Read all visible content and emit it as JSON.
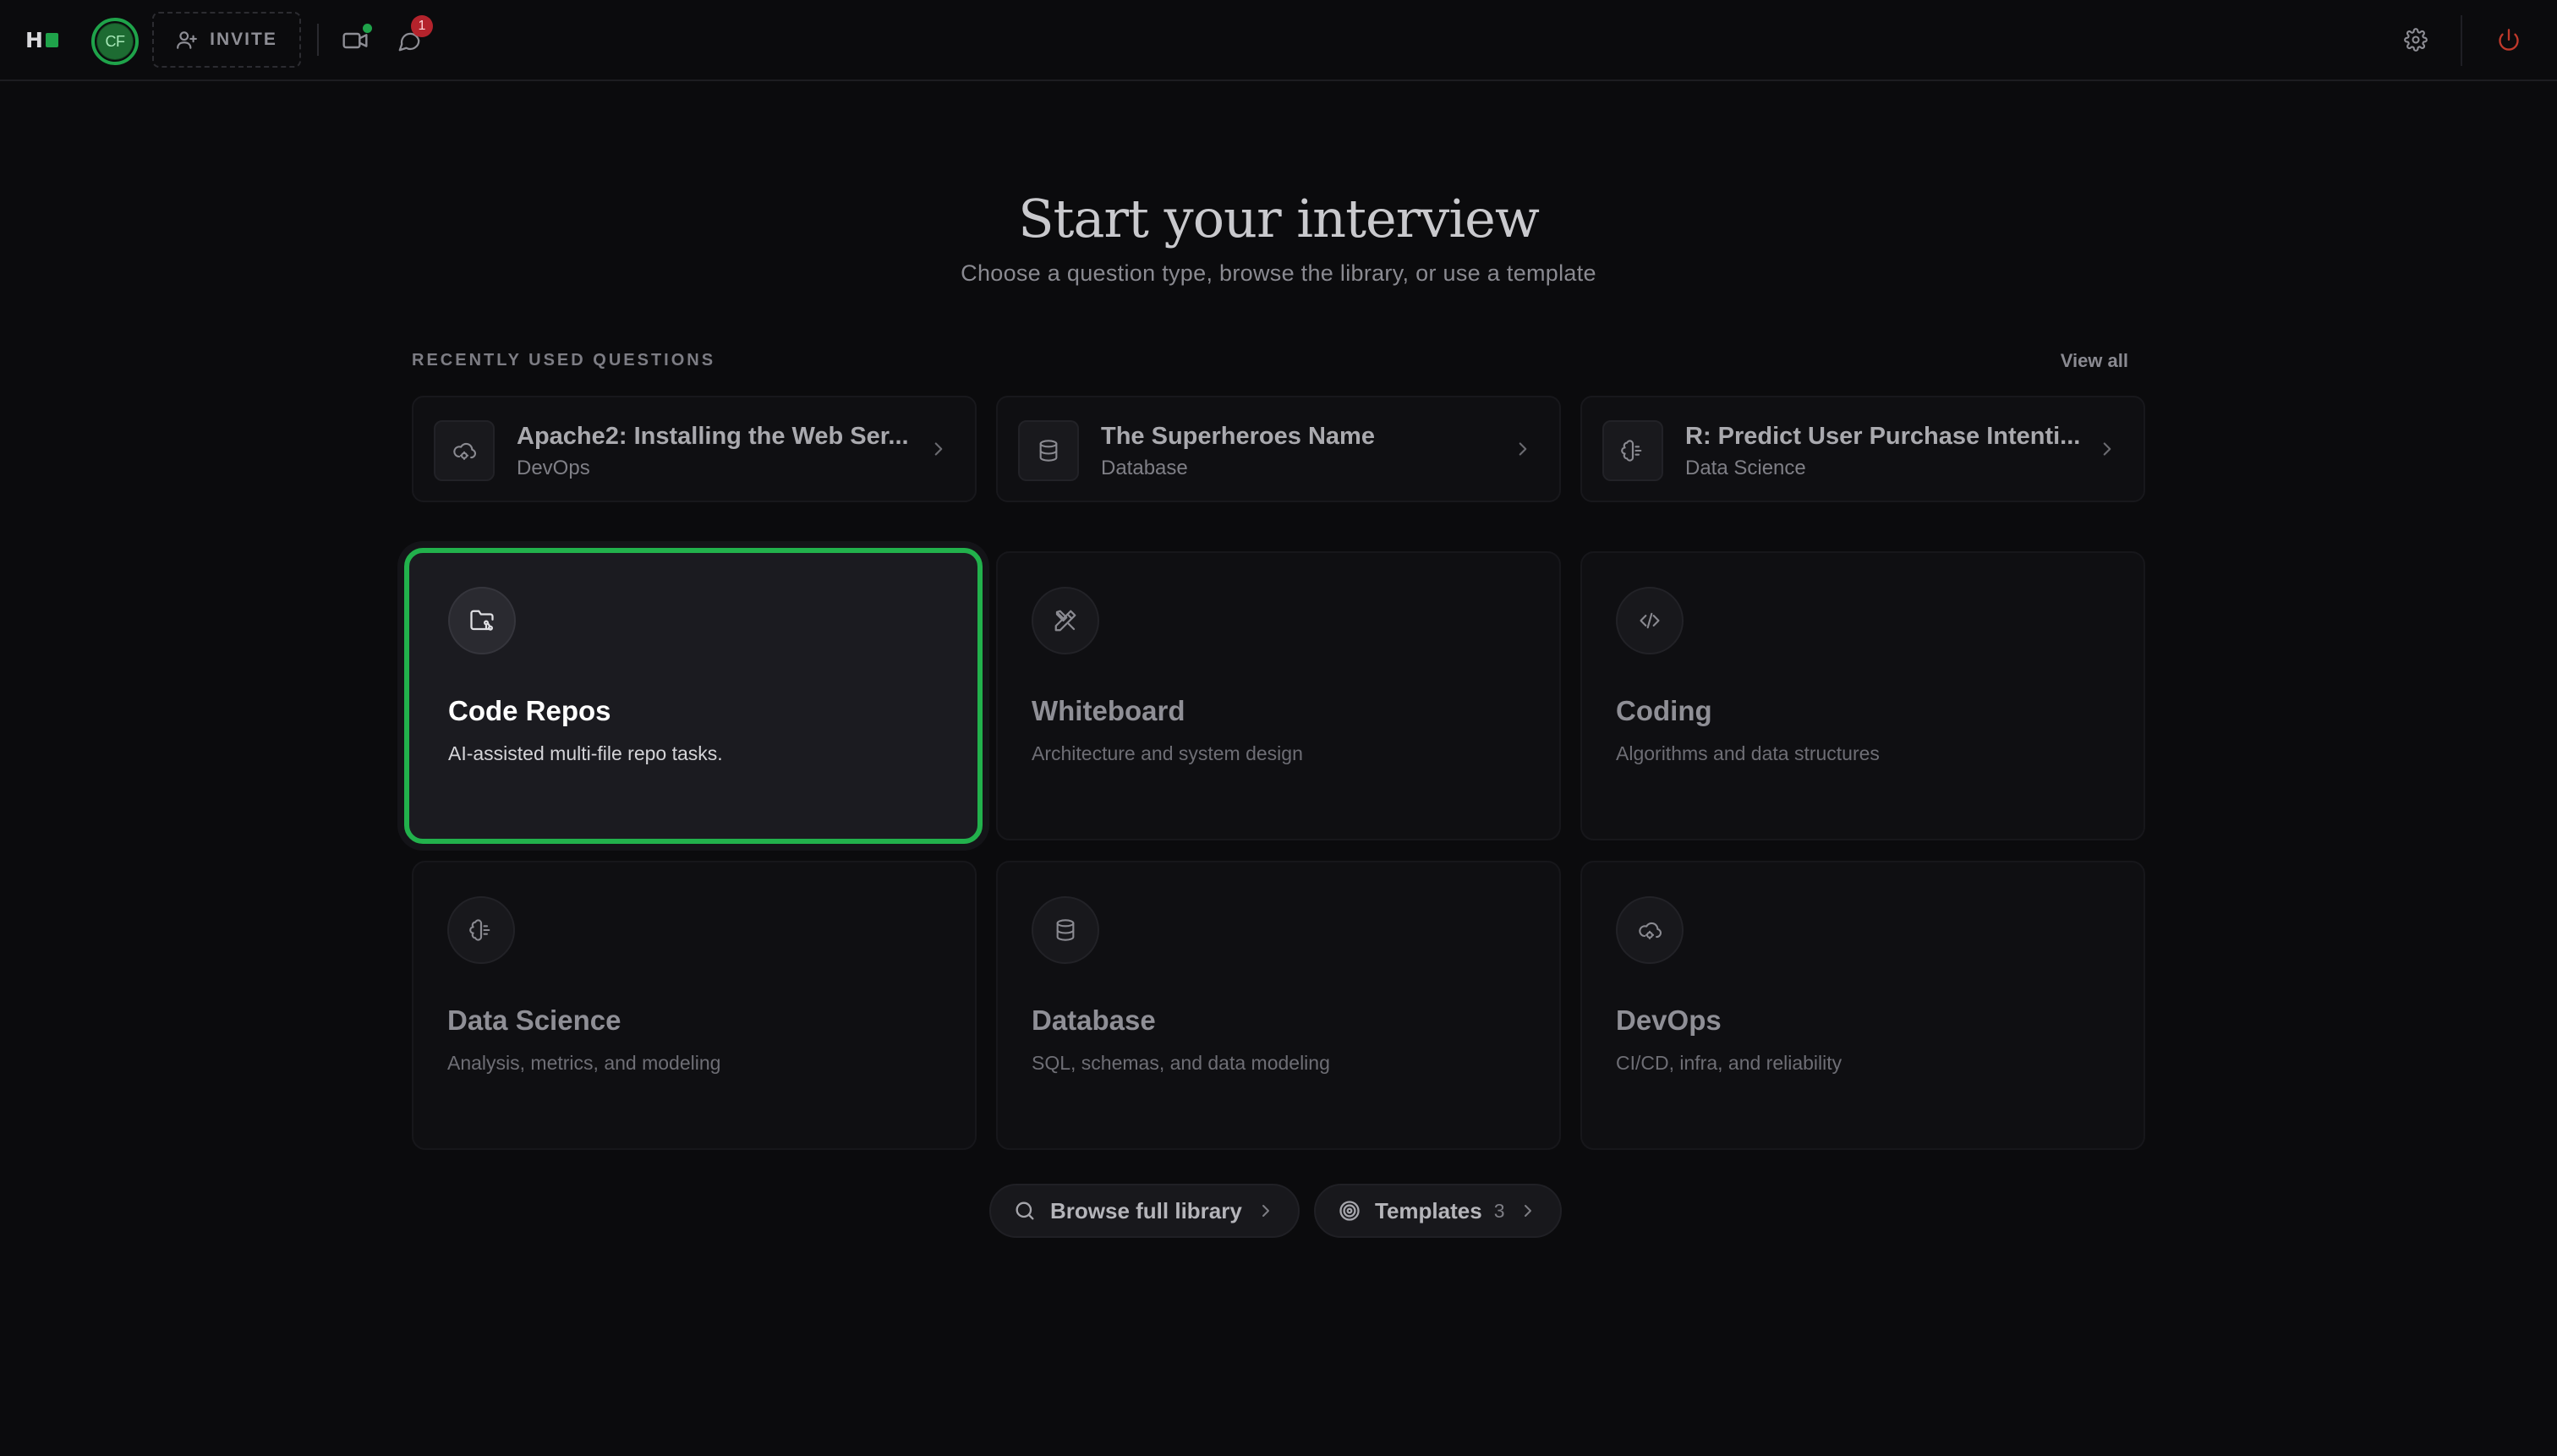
{
  "topbar": {
    "logo_text": "H",
    "avatar_initials": "CF",
    "invite_label": "INVITE",
    "notification_count": "1",
    "colors": {
      "accent": "#1fa34a",
      "badge": "#b4232c",
      "power": "#c0392b"
    }
  },
  "hero": {
    "title": "Start your interview",
    "subtitle": "Choose a question type, browse the library, or use a template"
  },
  "recent": {
    "label": "RECENTLY USED QUESTIONS",
    "view_all": "View all",
    "items": [
      {
        "title": "Apache2: Installing the Web Ser...",
        "category": "DevOps",
        "icon": "cloud-cog-icon"
      },
      {
        "title": "The Superheroes Name",
        "category": "Database",
        "icon": "database-icon"
      },
      {
        "title": "R: Predict User Purchase Intenti...",
        "category": "Data Science",
        "icon": "brain-icon"
      }
    ]
  },
  "types": [
    {
      "title": "Code Repos",
      "desc": "AI-assisted multi-file repo tasks.",
      "icon": "folder-git-icon",
      "selected": true
    },
    {
      "title": "Whiteboard",
      "desc": "Architecture and system design",
      "icon": "pencil-ruler-icon"
    },
    {
      "title": "Coding",
      "desc": "Algorithms and data structures",
      "icon": "code-icon"
    },
    {
      "title": "Data Science",
      "desc": "Analysis, metrics, and modeling",
      "icon": "brain-icon"
    },
    {
      "title": "Database",
      "desc": "SQL, schemas, and data modeling",
      "icon": "database-icon"
    },
    {
      "title": "DevOps",
      "desc": "CI/CD, infra, and reliability",
      "icon": "cloud-cog-icon"
    }
  ],
  "actions": {
    "browse_label": "Browse full library",
    "templates_label": "Templates",
    "templates_count": "3"
  }
}
